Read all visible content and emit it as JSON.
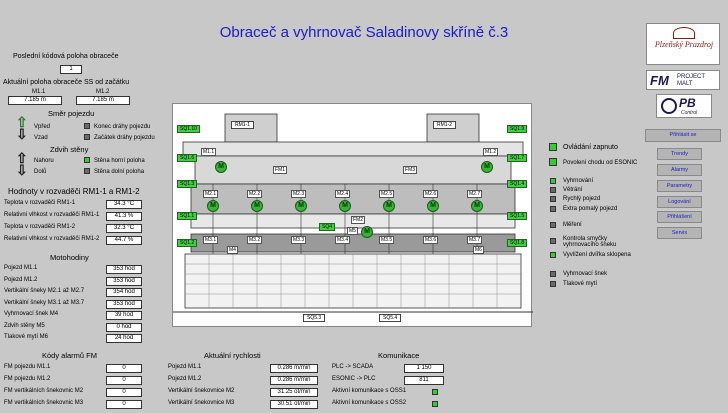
{
  "title": "Obraceč a vyhrnovač Saladinovy skříně č.3",
  "left": {
    "last_code_label": "Poslední kódová poloha obraceče",
    "last_code_value": "1",
    "actual_pos_label": "Aktuální poloha obraceče SS od začátku",
    "m11_label": "M1.1",
    "m12_label": "M1.2",
    "m11_value": "7.185 m",
    "m12_value": "7.185 m",
    "travel_dir_label": "Směr pojezdu",
    "forward": "Vpřed",
    "backward": "Vzad",
    "end_track": "Konec dráhy pojezdu",
    "start_track": "Začátek dráhy pojezdu",
    "wall_lift_label": "Zdvih stěny",
    "up": "Nahoru",
    "down": "Dolů",
    "wall_top": "Stěna horní poloha",
    "wall_bottom": "Stěna dolní poloha",
    "values_title": "Hodnoty v rozvaděči RM1-1 a RM1-2",
    "values": [
      {
        "label": "Teplota v rozvaděči RM1-1",
        "value": "34.3 °C"
      },
      {
        "label": "Relativní vlhkost v rozvaděči RM1-1",
        "value": "41.3 %"
      },
      {
        "label": "Teplota v rozvaděči RM1-2",
        "value": "32.3 °C"
      },
      {
        "label": "Relativní vlhkost v rozvaděči RM1-2",
        "value": "44.7 %"
      }
    ],
    "hours_title": "Motohodiny",
    "hours": [
      {
        "label": "Pojezd M1.1",
        "value": "353 hod"
      },
      {
        "label": "Pojezd M1.2",
        "value": "353 hod"
      },
      {
        "label": "Vertikální šneky M2.1 až M2.7",
        "value": "354 hod"
      },
      {
        "label": "Vertikální šneky M3.1 až M3.7",
        "value": "353 hod"
      },
      {
        "label": "Vyhrnovací šnek M4",
        "value": "39 hod"
      },
      {
        "label": "Zdvih stěny M5",
        "value": "0 hod"
      },
      {
        "label": "Tlakové mytí M6",
        "value": "24 hod"
      }
    ]
  },
  "bottom": {
    "alarm_title": "Kódy alarmů FM",
    "alarms": [
      {
        "label": "FM pojezdu M1.1",
        "value": "0"
      },
      {
        "label": "FM pojezdu M1.2",
        "value": "0"
      },
      {
        "label": "FM vertikálních šnekovnic M2",
        "value": "0"
      },
      {
        "label": "FM vertikálních šnekovnic M3",
        "value": "0"
      }
    ],
    "speed_title": "Aktuální rychlosti",
    "speeds": [
      {
        "label": "Pojezd M1.1",
        "value": "0.286 m/min"
      },
      {
        "label": "Pojezd M1.2",
        "value": "0.286 m/min"
      },
      {
        "label": "Vertikální šnekovnice M2",
        "value": "31.25 ot/min"
      },
      {
        "label": "Vertikální šnekovnice M3",
        "value": "30.51 ot/min"
      }
    ],
    "comm_title": "Komunikace",
    "comms": [
      {
        "label": "PLC -> SCADA",
        "value": "1 150"
      },
      {
        "label": "ESONIC -> PLC",
        "value": "811"
      },
      {
        "label": "Aktivní komunikace s OSS1",
        "value": ""
      },
      {
        "label": "Aktivní komunikace s OSS2",
        "value": ""
      }
    ]
  },
  "status": {
    "control_on": "Ovládání zapnuto",
    "esonic": "Povolení chodu od ESONIC",
    "items": [
      "Vyhrnování",
      "Větrání",
      "Rychlý pojezd",
      "Extra pomalý pojezd"
    ],
    "measure": "Měření",
    "loop": "Kontrola smyčky vyhrnovacího šneku",
    "gutter": "Vyvlížení dvířka sklopena",
    "items2": [
      "Vyhrnovací šnek",
      "Tlakové mytí"
    ]
  },
  "brand": {
    "logo1": "Plzeňský Prazdroj",
    "logo2_fm": "FM",
    "logo2_txt": "PROJECT MALT",
    "logo3_pb": "PB",
    "logo3_txt": "Control"
  },
  "nav": {
    "login": "Přihlásit se",
    "buttons": [
      "Trendy",
      "Alarmy",
      "Parametry",
      "Logování",
      "Přihlášení",
      "Servis"
    ]
  },
  "diagram": {
    "rm11": "RM1-1",
    "rm12": "RM1-2",
    "fm1": "FM1",
    "fm2": "FM2",
    "fm3": "FM3",
    "m5": "M5",
    "m1_1": "M1.1",
    "m1_2": "M1.2",
    "m2": [
      "M2.1",
      "M2.2",
      "M2.3",
      "M2.4",
      "M2.5",
      "M2.6",
      "M2.7"
    ],
    "m3": [
      "M3.1",
      "M3.2",
      "M3.3",
      "M3.4",
      "M3.5",
      "M3.6",
      "M3.7"
    ],
    "m4": "M4",
    "m6": "M6",
    "sq": [
      "SQ1.10",
      "SQ1.9",
      "SQ1.6",
      "SQ1.7",
      "SQ1.3",
      "SQ1.4",
      "SQ1.1",
      "SQ1.5",
      "SQ1.2",
      "SQ1.8",
      "SQ4",
      "SQ5.3",
      "SQ5.4"
    ],
    "motor_symbol": "M"
  }
}
